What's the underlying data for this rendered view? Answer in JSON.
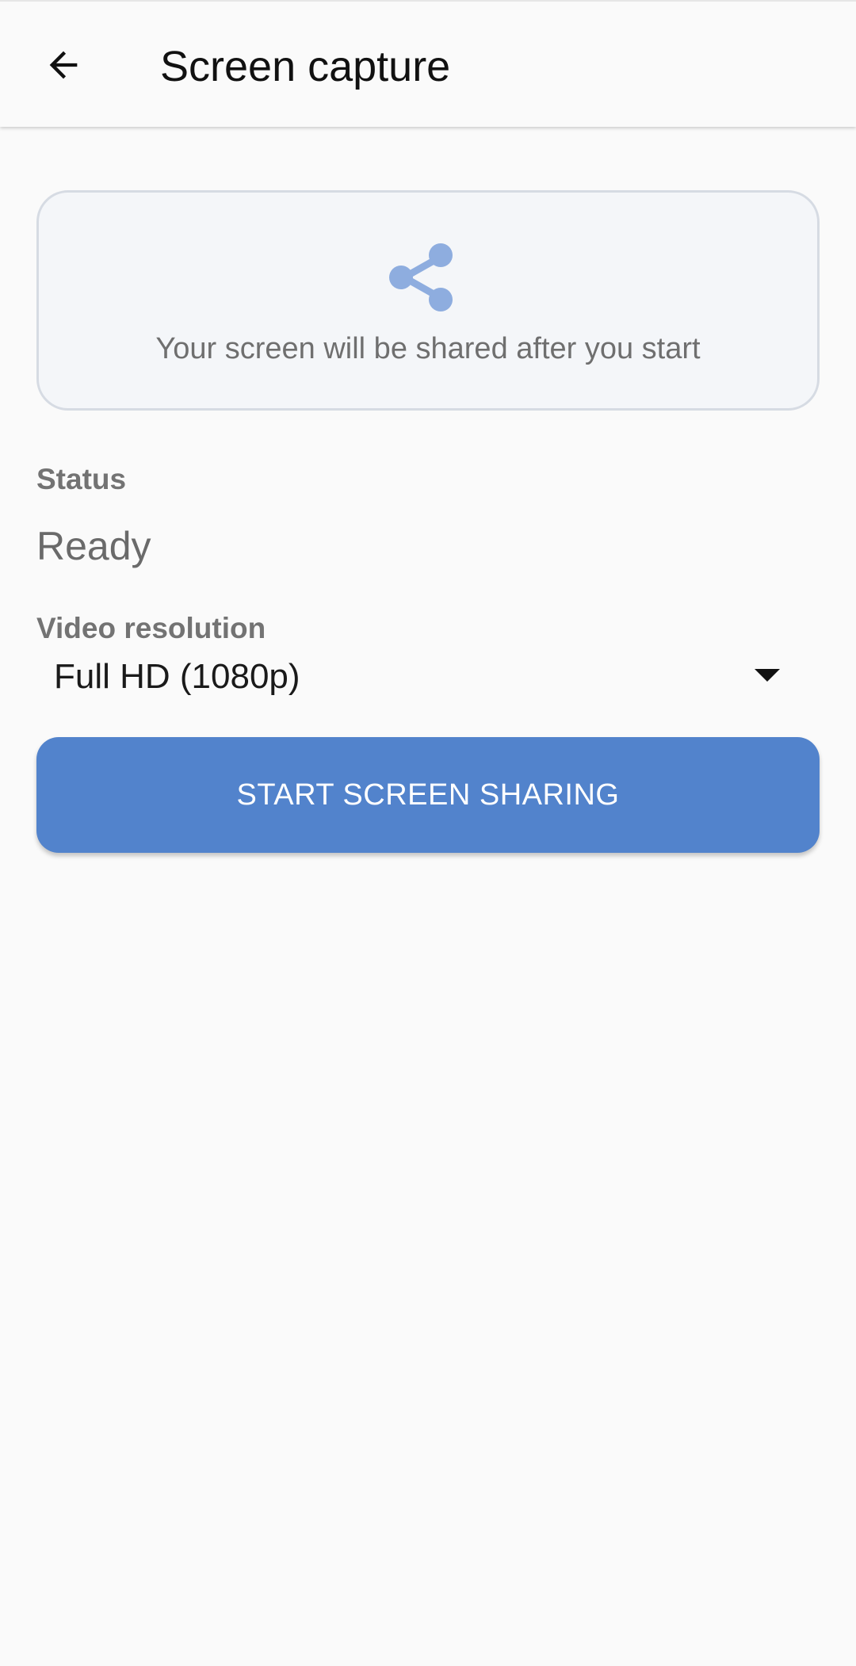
{
  "app_bar": {
    "title": "Screen capture",
    "back_icon": "arrow-left-icon"
  },
  "preview": {
    "icon": "share-icon",
    "message": "Your screen will be shared after you start"
  },
  "status": {
    "label": "Status",
    "value": "Ready"
  },
  "resolution": {
    "label": "Video resolution",
    "selected": "Full HD (1080p)"
  },
  "actions": {
    "start_label": "START SCREEN SHARING"
  },
  "colors": {
    "accent": "#5283cc",
    "share_icon": "#8eaddf",
    "background": "#fafafa"
  }
}
